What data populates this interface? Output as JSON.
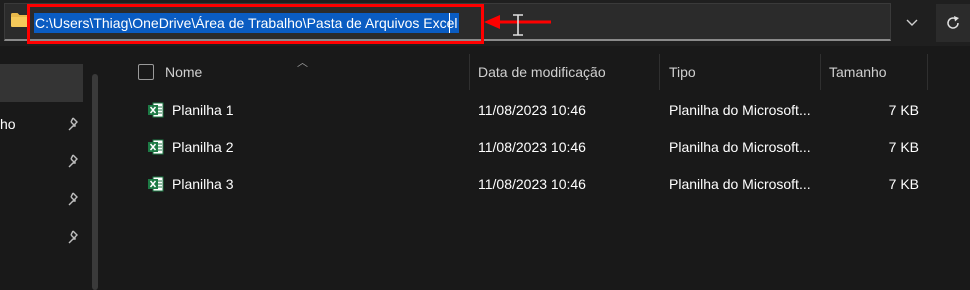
{
  "address_bar": {
    "path": "C:\\Users\\Thiag\\OneDrive\\Área de Trabalho\\Pasta de Arquivos Excel",
    "dropdown_icon": "chevron-down-icon",
    "refresh_icon": "refresh-icon"
  },
  "annotation": {
    "color": "#ff0000"
  },
  "sidebar": {
    "partial_label": "ho",
    "pinned_items": 4
  },
  "columns": {
    "name": "Nome",
    "date": "Data de modificação",
    "type": "Tipo",
    "size": "Tamanho"
  },
  "files": [
    {
      "name": "Planilha 1",
      "date": "11/08/2023 10:46",
      "type": "Planilha do Microsoft...",
      "size": "7 KB"
    },
    {
      "name": "Planilha 2",
      "date": "11/08/2023 10:46",
      "type": "Planilha do Microsoft...",
      "size": "7 KB"
    },
    {
      "name": "Planilha 3",
      "date": "11/08/2023 10:46",
      "type": "Planilha do Microsoft...",
      "size": "7 KB"
    }
  ],
  "colors": {
    "selection": "#0a5cc2",
    "excel_green": "#1d7a45",
    "background": "#191919"
  }
}
